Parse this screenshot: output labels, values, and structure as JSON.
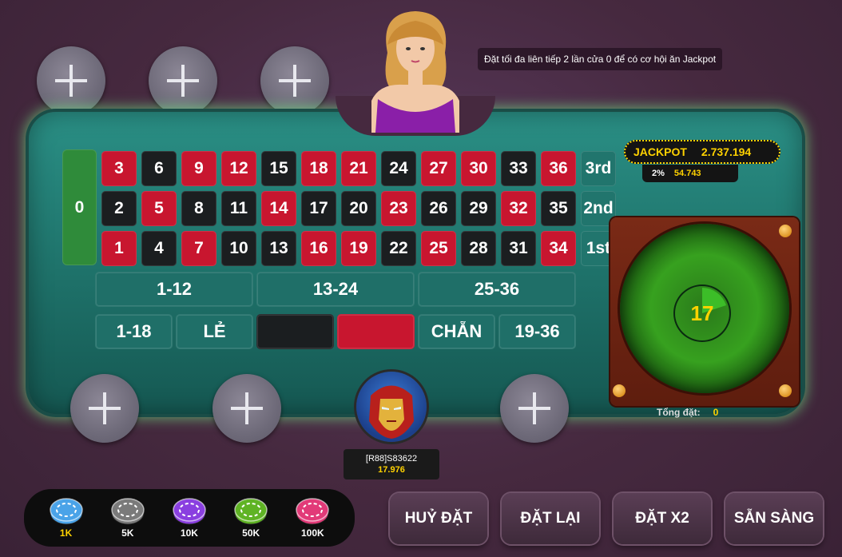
{
  "tip_text": "Đặt tối đa liên tiếp 2 lần cửa 0 để có cơ hội ăn Jackpot",
  "zero_label": "0",
  "rows": [
    {
      "label": "3rd",
      "cells": [
        {
          "n": "3",
          "c": "red"
        },
        {
          "n": "6",
          "c": "black"
        },
        {
          "n": "9",
          "c": "red"
        },
        {
          "n": "12",
          "c": "red"
        },
        {
          "n": "15",
          "c": "black"
        },
        {
          "n": "18",
          "c": "red"
        },
        {
          "n": "21",
          "c": "red"
        },
        {
          "n": "24",
          "c": "black"
        },
        {
          "n": "27",
          "c": "red"
        },
        {
          "n": "30",
          "c": "red"
        },
        {
          "n": "33",
          "c": "black"
        },
        {
          "n": "36",
          "c": "red"
        }
      ]
    },
    {
      "label": "2nd",
      "cells": [
        {
          "n": "2",
          "c": "black"
        },
        {
          "n": "5",
          "c": "red"
        },
        {
          "n": "8",
          "c": "black"
        },
        {
          "n": "11",
          "c": "black"
        },
        {
          "n": "14",
          "c": "red"
        },
        {
          "n": "17",
          "c": "black"
        },
        {
          "n": "20",
          "c": "black"
        },
        {
          "n": "23",
          "c": "red"
        },
        {
          "n": "26",
          "c": "black"
        },
        {
          "n": "29",
          "c": "black"
        },
        {
          "n": "32",
          "c": "red"
        },
        {
          "n": "35",
          "c": "black"
        }
      ]
    },
    {
      "label": "1st",
      "cells": [
        {
          "n": "1",
          "c": "red"
        },
        {
          "n": "4",
          "c": "black"
        },
        {
          "n": "7",
          "c": "red"
        },
        {
          "n": "10",
          "c": "black"
        },
        {
          "n": "13",
          "c": "black"
        },
        {
          "n": "16",
          "c": "red"
        },
        {
          "n": "19",
          "c": "red"
        },
        {
          "n": "22",
          "c": "black"
        },
        {
          "n": "25",
          "c": "red"
        },
        {
          "n": "28",
          "c": "black"
        },
        {
          "n": "31",
          "c": "black"
        },
        {
          "n": "34",
          "c": "red"
        }
      ]
    }
  ],
  "dozens": [
    "1-12",
    "13-24",
    "25-36"
  ],
  "even_money": {
    "low": "1-18",
    "odd": "LẺ",
    "even": "CHẴN",
    "high": "19-36"
  },
  "jackpot": {
    "label": "JACKPOT",
    "value": "2.737.194",
    "percent": "2%",
    "amount": "54.743"
  },
  "timer": "17",
  "total_bet": {
    "label": "Tổng đặt:",
    "value": "0"
  },
  "player": {
    "name": "[R88]S83622",
    "balance": "17.976"
  },
  "chips": [
    {
      "label": "1K",
      "color": "#4aa3e8",
      "selected": true
    },
    {
      "label": "5K",
      "color": "#7a7a7a",
      "selected": false
    },
    {
      "label": "10K",
      "color": "#8a3fe0",
      "selected": false
    },
    {
      "label": "50K",
      "color": "#5fb324",
      "selected": false
    },
    {
      "label": "100K",
      "color": "#e23a78",
      "selected": false
    }
  ],
  "buttons": {
    "cancel": "HUỶ ĐẶT",
    "rebet": "ĐẶT LẠI",
    "double": "ĐẶT X2",
    "ready": "SẴN SÀNG"
  }
}
